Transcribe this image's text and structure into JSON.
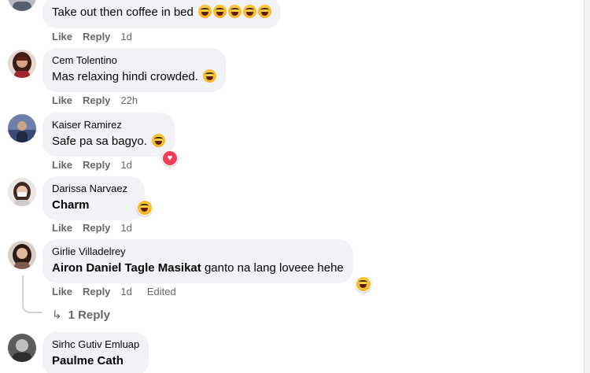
{
  "comments": [
    {
      "author": "",
      "text": "Take out then coffee in bed",
      "emoji_count": 5,
      "actions": {
        "like": "Like",
        "reply": "Reply",
        "time": "1d",
        "edited": ""
      },
      "reaction": null
    },
    {
      "author": "Cem Tolentino",
      "text": "Mas relaxing hindi crowded.",
      "emoji_count": 1,
      "actions": {
        "like": "Like",
        "reply": "Reply",
        "time": "22h",
        "edited": ""
      },
      "reaction": null
    },
    {
      "author": "Kaiser Ramirez",
      "text": "Safe pa sa bagyo.",
      "emoji_count": 1,
      "actions": {
        "like": "Like",
        "reply": "Reply",
        "time": "1d",
        "edited": ""
      },
      "reaction": "heart"
    },
    {
      "author": "Darissa Narvaez",
      "text": "Charm",
      "emoji_count": 0,
      "actions": {
        "like": "Like",
        "reply": "Reply",
        "time": "1d",
        "edited": ""
      },
      "reaction": "haha"
    },
    {
      "author": "Girlie Villadelrey",
      "mention": "Airon Daniel Tagle Masikat",
      "text": " ganto na lang loveee hehe",
      "emoji_count": 0,
      "actions": {
        "like": "Like",
        "reply": "Reply",
        "time": "1d",
        "edited": "Edited"
      },
      "reaction": "haha",
      "replies_label": "1 Reply"
    },
    {
      "author": "Sirhc Gutiv Emluap",
      "text": "Paulme Cath",
      "emoji_count": 0,
      "actions": null,
      "reaction": null
    }
  ],
  "icons": {
    "reply_arrow": "reply-arrow-icon",
    "heart_symbol": "♥"
  },
  "colors": {
    "bubble": "#f0f2f5",
    "meta_text": "#65676b",
    "heart": "#f33e58",
    "emoji": "#f7b125"
  }
}
